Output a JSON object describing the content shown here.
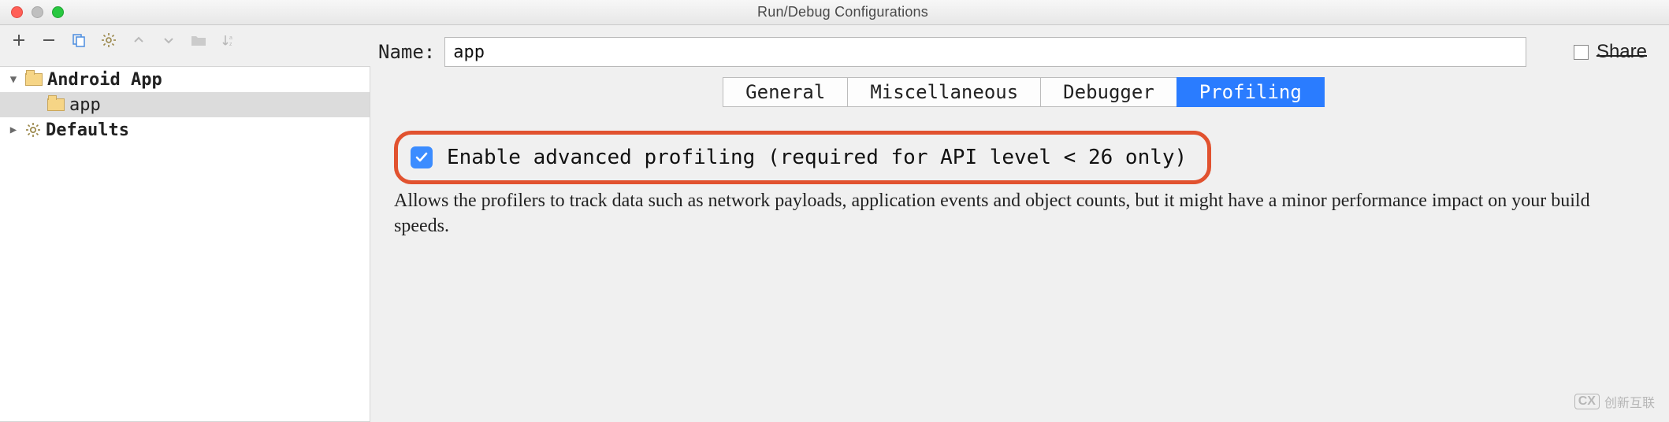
{
  "window": {
    "title": "Run/Debug Configurations"
  },
  "name_field": {
    "label": "Name:",
    "value": "app"
  },
  "share": {
    "label": "Share",
    "checked": false
  },
  "sidebar": {
    "items": [
      {
        "label": "Android App",
        "expanded": true,
        "level": 0,
        "icon": "folder"
      },
      {
        "label": "app",
        "expanded": null,
        "level": 1,
        "icon": "folder",
        "selected": true
      },
      {
        "label": "Defaults",
        "expanded": false,
        "level": 0,
        "icon": "gear"
      }
    ]
  },
  "tabs": [
    {
      "label": "General",
      "active": false
    },
    {
      "label": "Miscellaneous",
      "active": false
    },
    {
      "label": "Debugger",
      "active": false
    },
    {
      "label": "Profiling",
      "active": true
    }
  ],
  "profiling": {
    "enable_label": "Enable advanced profiling (required for API level < 26 only)",
    "enable_checked": true,
    "description": "Allows the profilers to track data such as network payloads, application events and object counts, but it might have a minor performance impact on your build speeds."
  },
  "watermark": {
    "brand": "创新互联",
    "badge": "CX"
  }
}
